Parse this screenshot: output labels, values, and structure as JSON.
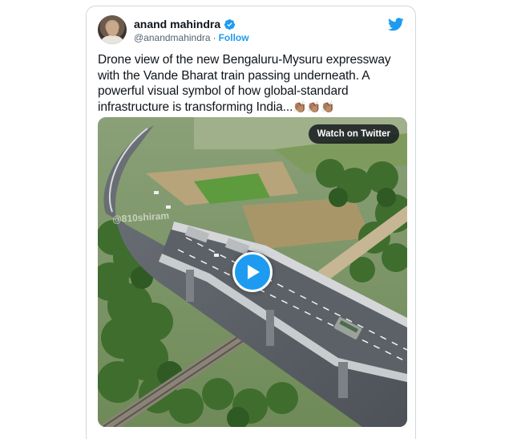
{
  "tweet": {
    "display_name": "anand mahindra",
    "handle": "@anandmahindra",
    "separator": "·",
    "follow_label": "Follow",
    "text": "Drone view of the new Bengaluru-Mysuru expressway with the Vande Bharat train passing underneath. A powerful visual symbol of how global-standard infrastructure is transforming India...",
    "emoji": "👏🏽👏🏽👏🏽",
    "verified": true
  },
  "media": {
    "watch_label": "Watch on Twitter",
    "watermark": "@810shiram"
  },
  "icons": {
    "avatar": "avatar",
    "verified": "verified-badge-icon",
    "brand": "twitter-bird-icon",
    "play": "play-icon"
  },
  "colors": {
    "brand": "#1d9bf0",
    "text": "#0f1419",
    "muted": "#536471",
    "border": "#cfd9de"
  }
}
